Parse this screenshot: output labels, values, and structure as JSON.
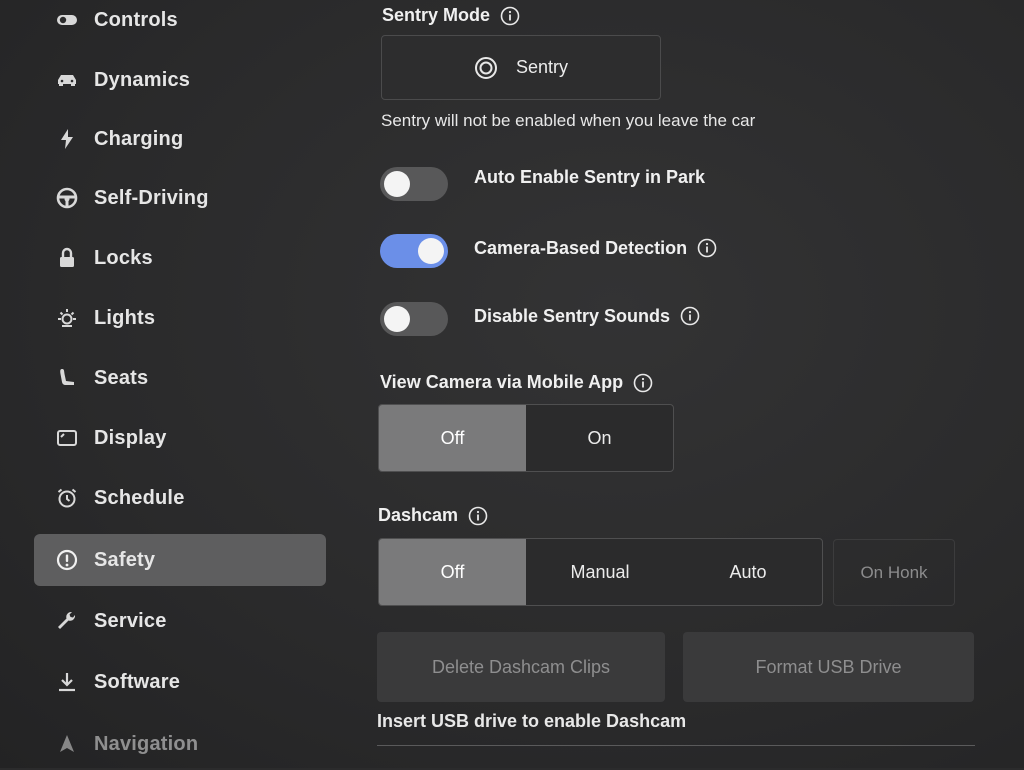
{
  "sidebar": {
    "items": [
      {
        "label": "Controls",
        "icon": "toggle-icon"
      },
      {
        "label": "Dynamics",
        "icon": "car-icon"
      },
      {
        "label": "Charging",
        "icon": "lightning-icon"
      },
      {
        "label": "Self-Driving",
        "icon": "steering-wheel-icon"
      },
      {
        "label": "Locks",
        "icon": "lock-icon"
      },
      {
        "label": "Lights",
        "icon": "sun-icon"
      },
      {
        "label": "Seats",
        "icon": "seat-icon"
      },
      {
        "label": "Display",
        "icon": "display-icon"
      },
      {
        "label": "Schedule",
        "icon": "alarm-clock-icon"
      },
      {
        "label": "Safety",
        "icon": "alert-circle-icon",
        "active": true
      },
      {
        "label": "Service",
        "icon": "wrench-icon"
      },
      {
        "label": "Software",
        "icon": "download-icon"
      },
      {
        "label": "Navigation",
        "icon": "navigation-arrow-icon"
      }
    ]
  },
  "sentry": {
    "title": "Sentry Mode",
    "button_label": "Sentry",
    "note": "Sentry will not be enabled when you leave the car"
  },
  "toggles": {
    "auto_enable": {
      "label": "Auto Enable Sentry in Park",
      "on": false
    },
    "camera_detection": {
      "label": "Camera-Based Detection",
      "on": true
    },
    "disable_sounds": {
      "label": "Disable Sentry Sounds",
      "on": false
    }
  },
  "view_camera": {
    "title": "View Camera via Mobile App",
    "options": [
      "Off",
      "On"
    ],
    "selected": "Off"
  },
  "dashcam": {
    "title": "Dashcam",
    "options": [
      "Off",
      "Manual",
      "Auto"
    ],
    "selected": "Off",
    "on_honk": "On Honk",
    "delete_clips": "Delete Dashcam Clips",
    "format_usb": "Format USB Drive",
    "note": "Insert USB drive to enable Dashcam"
  },
  "colors": {
    "accent": "#6b8fe8",
    "active_bg": "#5e5e5f"
  }
}
